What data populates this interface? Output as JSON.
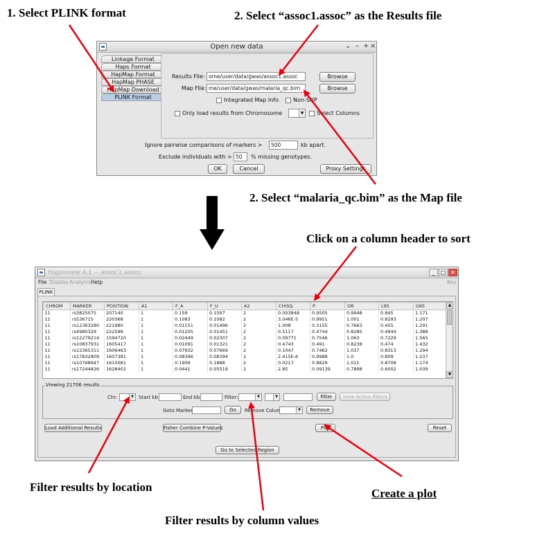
{
  "annotations": {
    "step1": "1. Select PLINK format",
    "step2_results": "2. Select “assoc1.assoc” as the Results file",
    "step2_map": "2. Select “malaria_qc.bim” as the Map file",
    "sort": "Click on a column header to sort",
    "filter_location": "Filter results by location",
    "filter_values": "Filter results by column values",
    "create_plot": "Create a plot"
  },
  "dialog": {
    "title": "Open new data",
    "tabs": [
      "Linkage Format",
      "Haps Format",
      "HapMap Format",
      "HapMap PHASE",
      "HapMap Download",
      "PLINK Format"
    ],
    "selected_tab": "PLINK Format",
    "results_label": "Results File:",
    "results_value": "ome/user/data/gwas/assoc1.assoc",
    "map_label": "Map File:",
    "map_value": "me/user/data/gwas/malaria_qc.bim",
    "browse": "Browse",
    "integrated_map": "Integrated Map Info",
    "non_snp": "Non-SNP",
    "only_chrom": "Only load results from Chromosome",
    "select_columns": "Select Columns",
    "ignore_label": "Ignore pairwise comparisons of markers >",
    "ignore_value": "500",
    "ignore_unit": "kb apart.",
    "exclude_label": "Exclude individuals with >",
    "exclude_value": "50",
    "exclude_unit": "% missing genotypes.",
    "ok": "OK",
    "cancel": "Cancel",
    "proxy": "Proxy Settings"
  },
  "haploview": {
    "title": "Haploview 4.1 -- assoc1.assoc",
    "menus": [
      "File",
      "Display",
      "Analysis",
      "Help"
    ],
    "menu_right": "Key",
    "tab": "PLINK",
    "columns": [
      "CHROM",
      "MARKER",
      "POSITION",
      "A1",
      "F_A",
      "F_U",
      "A2",
      "CHISQ",
      "P",
      "OR",
      "L95",
      "U95"
    ],
    "rows": [
      [
        "11",
        "rs3825075",
        "207140",
        "1",
        "0.159",
        "0.1597",
        "2",
        "0.003848",
        "0.9505",
        "0.9948",
        "0.845",
        "1.171"
      ],
      [
        "11",
        "rs536715",
        "220368",
        "1",
        "0.1083",
        "0.1082",
        "2",
        "3.046E-5",
        "0.9951",
        "1.001",
        "0.8293",
        "1.207"
      ],
      [
        "11",
        "rs12363280",
        "221980",
        "1",
        "0.01151",
        "0.01496",
        "2",
        "1.008",
        "0.3155",
        "0.7663",
        "0.455",
        "1.291"
      ],
      [
        "11",
        "rs4980329",
        "222598",
        "1",
        "0.01205",
        "0.01451",
        "2",
        "0.5117",
        "0.4744",
        "0.8285",
        "0.4944",
        "1.388"
      ],
      [
        "11",
        "rs12279214",
        "1594720",
        "1",
        "0.02449",
        "0.02307",
        "2",
        "0.09771",
        "0.7546",
        "1.063",
        "0.7229",
        "1.565"
      ],
      [
        "11",
        "rs10837931",
        "1605417",
        "1",
        "0.01091",
        "0.01321",
        "2",
        "0.4743",
        "0.491",
        "0.8238",
        "0.474",
        "1.432"
      ],
      [
        "11",
        "rs12365311",
        "1606463",
        "1",
        "0.07932",
        "0.07669",
        "2",
        "0.1047",
        "0.7462",
        "1.037",
        "0.8313",
        "1.294"
      ],
      [
        "11",
        "rs17832809",
        "1607381",
        "1",
        "0.08396",
        "0.08394",
        "2",
        "2.415E-6",
        "0.9988",
        "1.0",
        "0.809",
        "1.237"
      ],
      [
        "11",
        "rs10768947",
        "1610081",
        "1",
        "0.1906",
        "0.1888",
        "2",
        "0.0217",
        "0.8829",
        "1.011",
        "0.8708",
        "1.174"
      ],
      [
        "11",
        "rs17244826",
        "1628402",
        "1",
        "0.0441",
        "0.05519",
        "2",
        "2.85",
        "0.09139",
        "0.7898",
        "0.6002",
        "1.039"
      ]
    ],
    "viewing": "Viewing 21706 results",
    "chr": "Chr:",
    "start_kb": "Start kb:",
    "end_kb": "End kb:",
    "filter": "Filter:",
    "filter_btn": "Filter",
    "view_active": "View Active Filters",
    "goto_marker": "Goto Marker:",
    "go": "Go",
    "remove_column": "Remove Column:",
    "remove": "Remove",
    "load_additional": "Load Additional Results",
    "fisher": "Fisher Combine P-Values",
    "plot": "Plot",
    "reset": "Reset",
    "goto_region": "Go to Selected Region"
  },
  "colors": {
    "arrow": "#e8000b",
    "selected_tab": "#b9cde6"
  }
}
